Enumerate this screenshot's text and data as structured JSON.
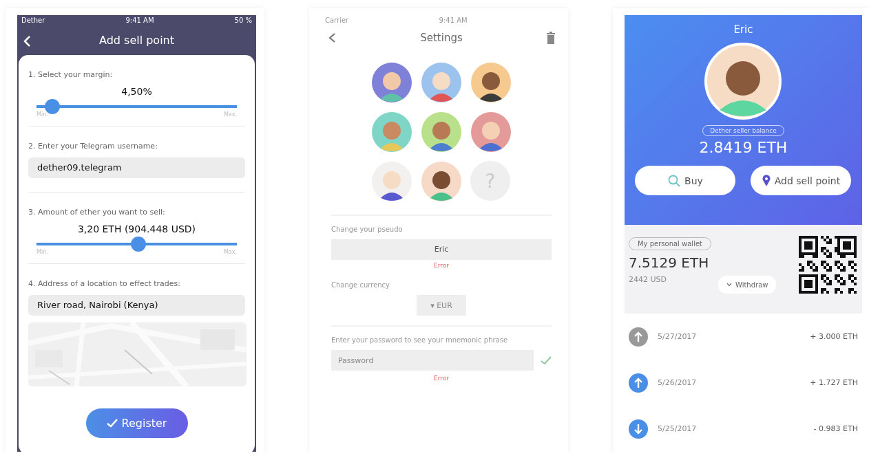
{
  "sell_point": {
    "status_bar": {
      "carrier": "Dether",
      "time": "9:41 AM",
      "battery": "50 %"
    },
    "title": "Add sell point",
    "steps": [
      {
        "kind": "slider",
        "label": "1. Select your margin:",
        "reading": "4,50%",
        "level": 0.08,
        "min": "Min.",
        "max": "Max."
      },
      {
        "kind": "field",
        "label": "2. Enter your Telegram username:",
        "value": "dether09.telegram"
      },
      {
        "kind": "slider",
        "label": "3. Amount of ether you want to sell:",
        "reading": "3,20 ETH (904.448 USD)",
        "level": 0.51,
        "min": "Min.",
        "max": "Max."
      },
      {
        "kind": "address",
        "label": "4. Address of a location to effect trades:",
        "value": "River road, Nairobi (Kenya)"
      }
    ],
    "button": "Register"
  },
  "settings": {
    "status_bar": {
      "carrier": "Carrier",
      "time": "9:41 AM"
    },
    "title": "Settings",
    "avatars": [
      {
        "kind": "avatar",
        "color": "#7f80d8"
      },
      {
        "kind": "avatar",
        "color": "#9cc3ee"
      },
      {
        "kind": "avatar",
        "color": "#f6c98e"
      },
      {
        "kind": "avatar",
        "color": "#7fd6c6"
      },
      {
        "kind": "avatar",
        "color": "#b9e08a"
      },
      {
        "kind": "avatar",
        "color": "#e49a98"
      },
      {
        "kind": "avatar",
        "color": "#f3f0f0"
      },
      {
        "kind": "avatar",
        "color": "#f6d9c6"
      },
      {
        "kind": "unknown",
        "label": "?"
      }
    ],
    "pseudo": {
      "label": "Change your pseudo",
      "value": "Eric",
      "error": "Error"
    },
    "currency": {
      "label": "Change currency",
      "value": "▾ EUR"
    },
    "password": {
      "label": "Enter your password to see your mnemonic phrase",
      "placeholder": "Password",
      "error": "Error"
    }
  },
  "wallet": {
    "name": "Eric",
    "seller_badge": "Dether seller balance",
    "seller_balance": "2.8419 ETH",
    "buttons": [
      {
        "kind": "buy",
        "label": "Buy"
      },
      {
        "kind": "sell",
        "label": "Add sell point"
      }
    ],
    "personal_badge": "My personal wallet",
    "balance": "7.5129 ETH",
    "balance_usd": "2442 USD",
    "withdraw": "Withdraw",
    "transactions": [
      {
        "kind": "pending",
        "date": "5/27/2017",
        "amount": "+ 3.000 ETH"
      },
      {
        "kind": "received",
        "date": "5/26/2017",
        "amount": "+ 1.727 ETH"
      },
      {
        "kind": "sent",
        "date": "5/25/2017",
        "amount": "- 0.983 ETH"
      }
    ]
  }
}
